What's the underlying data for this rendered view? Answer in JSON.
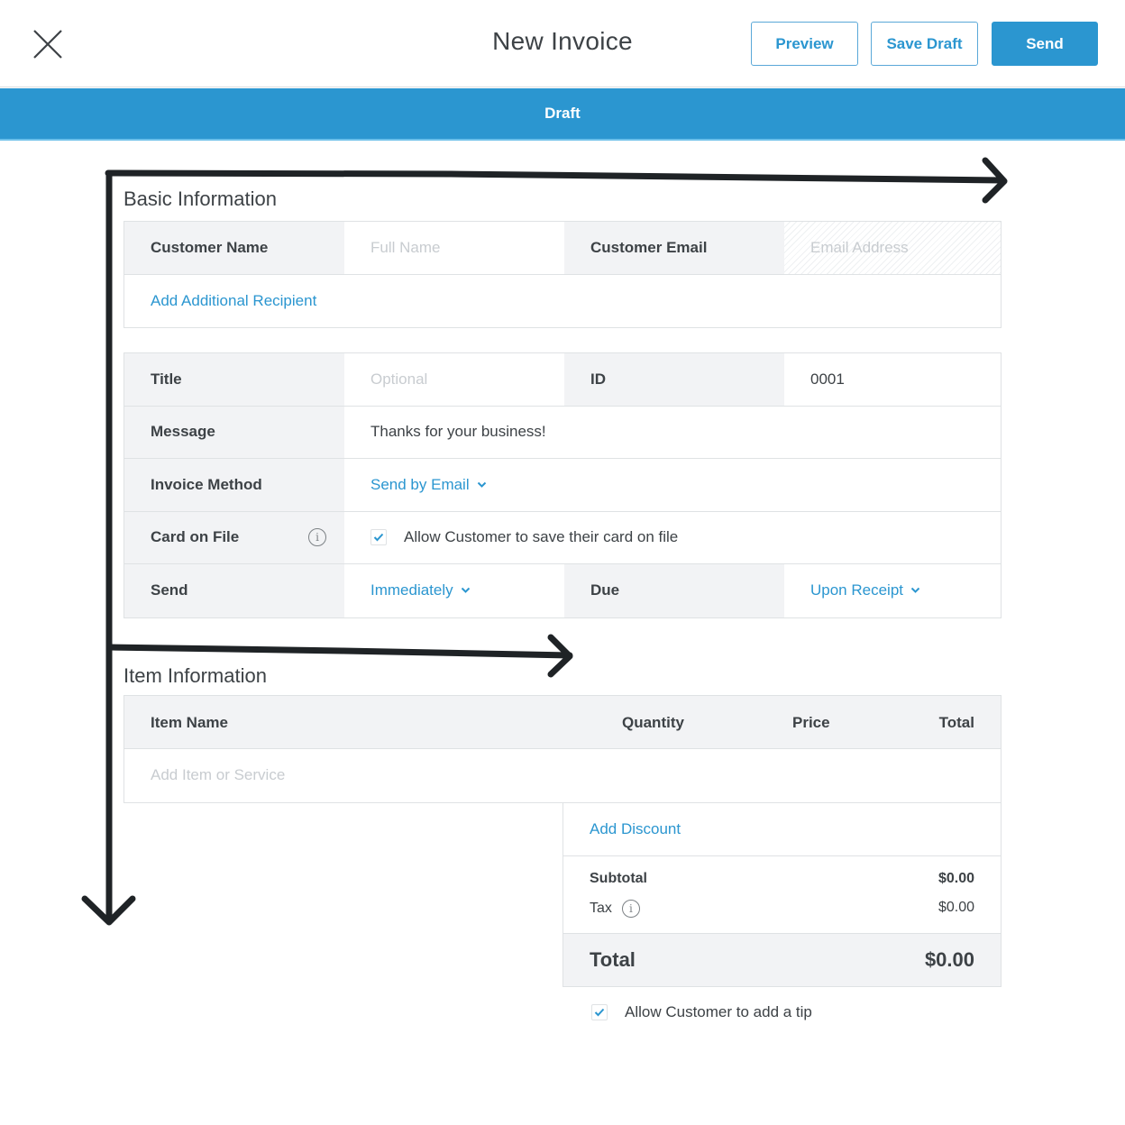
{
  "header": {
    "title": "New Invoice",
    "close_icon": "close-x-icon",
    "buttons": {
      "preview": "Preview",
      "save_draft": "Save Draft",
      "send": "Send"
    }
  },
  "status": {
    "label": "Draft",
    "color": "#2b96d0"
  },
  "basic_information": {
    "title": "Basic Information",
    "customer_name": {
      "label": "Customer Name",
      "placeholder": "Full Name"
    },
    "customer_email": {
      "label": "Customer Email",
      "placeholder": "Email Address"
    },
    "add_recipient": "Add Additional Recipient"
  },
  "details": {
    "title_field": {
      "label": "Title",
      "placeholder": "Optional"
    },
    "id_field": {
      "label": "ID",
      "value": "0001"
    },
    "message": {
      "label": "Message",
      "value": "Thanks for your business!"
    },
    "invoice_method": {
      "label": "Invoice Method",
      "value": "Send by Email"
    },
    "card_on_file": {
      "label": "Card on File",
      "checked": true,
      "text": "Allow Customer to save their card on file"
    },
    "send": {
      "label": "Send",
      "value": "Immediately"
    },
    "due": {
      "label": "Due",
      "value": "Upon Receipt"
    }
  },
  "item_information": {
    "title": "Item Information",
    "columns": [
      "Item Name",
      "Quantity",
      "Price",
      "Total"
    ],
    "add_item_placeholder": "Add Item or Service"
  },
  "summary": {
    "add_discount": "Add Discount",
    "subtotal_label": "Subtotal",
    "subtotal_value": "$0.00",
    "tax_label": "Tax",
    "tax_value": "$0.00",
    "total_label": "Total",
    "total_value": "$0.00"
  },
  "tip": {
    "checked": true,
    "text": "Allow Customer to add a tip"
  },
  "colors": {
    "accent": "#2b96d0",
    "label_bg": "#f2f3f5",
    "border": "#dfe2e4",
    "annotation": "#1f2326"
  }
}
